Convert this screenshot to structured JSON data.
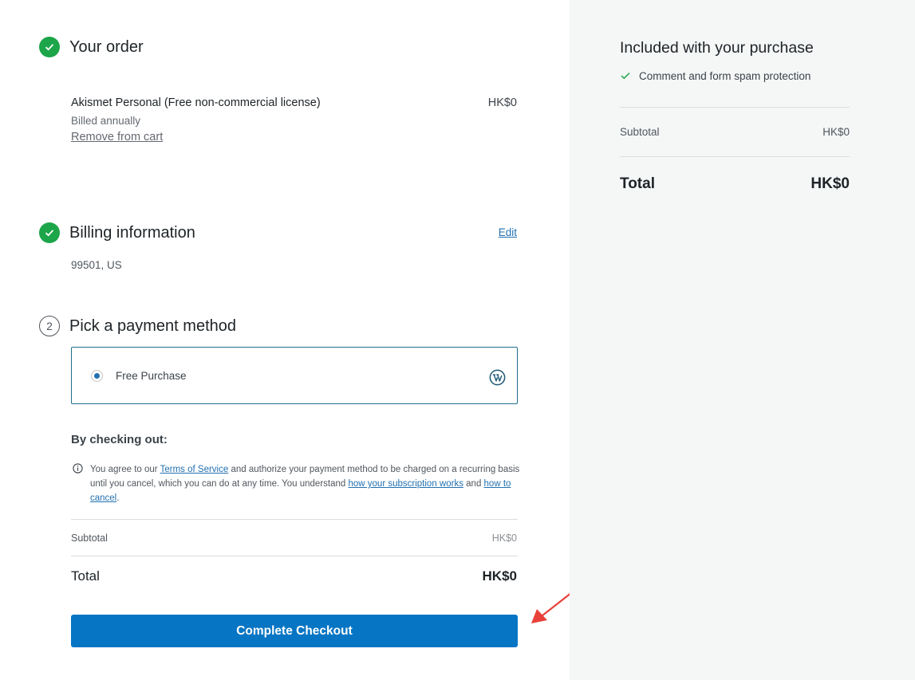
{
  "order": {
    "title": "Your order",
    "item_name": "Akismet Personal (Free non-commercial license)",
    "item_price": "HK$0",
    "billing_period": "Billed annually",
    "remove_label": "Remove from cart"
  },
  "billing": {
    "title": "Billing information",
    "edit_label": "Edit",
    "address": "99501, US"
  },
  "payment": {
    "step_number": "2",
    "title": "Pick a payment method",
    "option_label": "Free Purchase",
    "option_selected": true
  },
  "terms": {
    "heading": "By checking out:",
    "text_1": "You agree to our ",
    "tos_link": "Terms of Service",
    "text_2": " and authorize your payment method to be charged on a recurring basis until you cancel, which you can do at any time. You understand ",
    "subscription_link": "how your subscription works",
    "text_3": " and ",
    "cancel_link": "how to cancel",
    "text_4": "."
  },
  "summary": {
    "subtotal_label": "Subtotal",
    "subtotal_value": "HK$0",
    "total_label": "Total",
    "total_value": "HK$0"
  },
  "checkout_button": "Complete Checkout",
  "sidebar": {
    "title": "Included with your purchase",
    "items": [
      "Comment and form spam protection"
    ],
    "subtotal_label": "Subtotal",
    "subtotal_value": "HK$0",
    "total_label": "Total",
    "total_value": "HK$0"
  },
  "colors": {
    "accent": "#0675c4",
    "success": "#1ca549",
    "annotation_arrow": "#e8403a"
  },
  "icons": [
    "check-icon",
    "info-icon",
    "wordpress-icon",
    "annotation-arrow"
  ]
}
